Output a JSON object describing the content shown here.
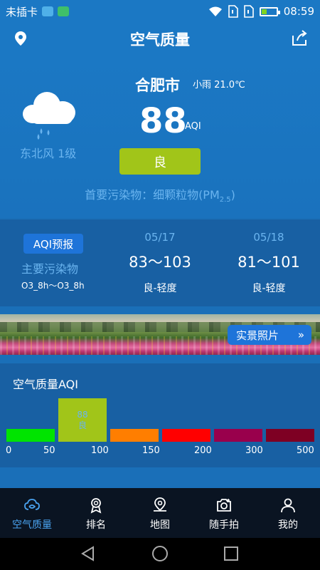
{
  "status_bar": {
    "carrier": "未插卡",
    "time": "08:59",
    "battery_level": 0.35
  },
  "header": {
    "title": "空气质量",
    "left_icon": "location-pin-icon",
    "right_icon": "share-icon"
  },
  "current": {
    "city": "合肥市",
    "weather": "小雨 21.0℃",
    "weather_icon": "cloud-rain-icon",
    "wind": "东北风 1级",
    "aqi": "88",
    "aqi_unit": "AQI",
    "level": "良",
    "primary_pollutant_prefix": "首要污染物：细颗粒物(PM",
    "primary_pollutant_sub": "2.5",
    "primary_pollutant_suffix": ")"
  },
  "forecast": {
    "badge": "AQI预报",
    "label": "主要污染物",
    "pollutant": "O3_8h～O3_8h",
    "days": [
      {
        "date": "05/17",
        "range": "83～103",
        "level": "良-轻度"
      },
      {
        "date": "05/18",
        "range": "81～101",
        "level": "良-轻度"
      }
    ]
  },
  "photo_banner": {
    "button": "实景照片",
    "chevron": "»"
  },
  "aqi_scale": {
    "title": "空气质量AQI",
    "current_value": "88",
    "current_level": "良",
    "segments": [
      {
        "color": "#00e400"
      },
      {
        "color": "#a1c519"
      },
      {
        "color": "#ff7e00"
      },
      {
        "color": "#ff0000"
      },
      {
        "color": "#99004c"
      },
      {
        "color": "#7e0023"
      }
    ],
    "ticks": [
      "0",
      "50",
      "100",
      "150",
      "200",
      "300",
      "500"
    ]
  },
  "tabs": [
    {
      "label": "空气质量",
      "icon": "air-quality-icon",
      "active": true
    },
    {
      "label": "排名",
      "icon": "ranking-medal-icon",
      "active": false
    },
    {
      "label": "地图",
      "icon": "map-pin-icon",
      "active": false
    },
    {
      "label": "随手拍",
      "icon": "camera-icon",
      "active": false
    },
    {
      "label": "我的",
      "icon": "user-icon",
      "active": false
    }
  ],
  "colors": {
    "primary": "#1b78c4",
    "panel": "#1860a3",
    "accent_button": "#1e74d9",
    "good": "#a1c519",
    "muted_text": "#6ab4ef",
    "tab_active": "#4aa3f0"
  }
}
